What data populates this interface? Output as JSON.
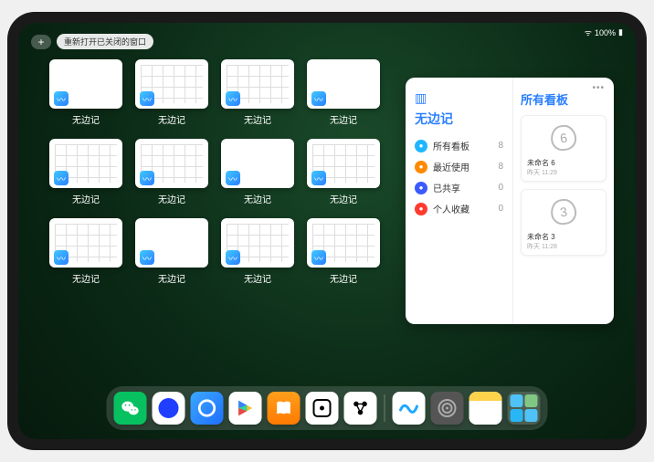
{
  "status": {
    "time": "",
    "battery": "100%"
  },
  "top": {
    "plus": "+",
    "reopen_label": "重新打开已关闭的窗口"
  },
  "app_label": "无边记",
  "windows": [
    {
      "grid": false
    },
    {
      "grid": true
    },
    {
      "grid": true
    },
    {
      "grid": false
    },
    {
      "grid": true
    },
    {
      "grid": true
    },
    {
      "grid": false
    },
    {
      "grid": true
    },
    {
      "grid": true
    },
    {
      "grid": false
    },
    {
      "grid": true
    },
    {
      "grid": true
    }
  ],
  "panel": {
    "left_title": "无边记",
    "right_title": "所有看板",
    "categories": [
      {
        "label": "所有看板",
        "count": 8,
        "color": "#1fb6ff"
      },
      {
        "label": "最近使用",
        "count": 8,
        "color": "#ff8a00"
      },
      {
        "label": "已共享",
        "count": 0,
        "color": "#3b5bff"
      },
      {
        "label": "个人收藏",
        "count": 0,
        "color": "#ff3b30"
      }
    ],
    "boards": [
      {
        "glyph": "6",
        "name": "未命名 6",
        "sub": "昨天 11:29"
      },
      {
        "glyph": "3",
        "name": "未命名 3",
        "sub": "昨天 11:28"
      }
    ]
  },
  "dock": {
    "apps": [
      {
        "name": "wechat"
      },
      {
        "name": "quark"
      },
      {
        "name": "qqbrowser"
      },
      {
        "name": "play"
      },
      {
        "name": "books"
      },
      {
        "name": "dice"
      },
      {
        "name": "connect"
      }
    ],
    "recent": [
      {
        "name": "freeform"
      },
      {
        "name": "settings"
      },
      {
        "name": "notes"
      },
      {
        "name": "folder"
      }
    ]
  }
}
